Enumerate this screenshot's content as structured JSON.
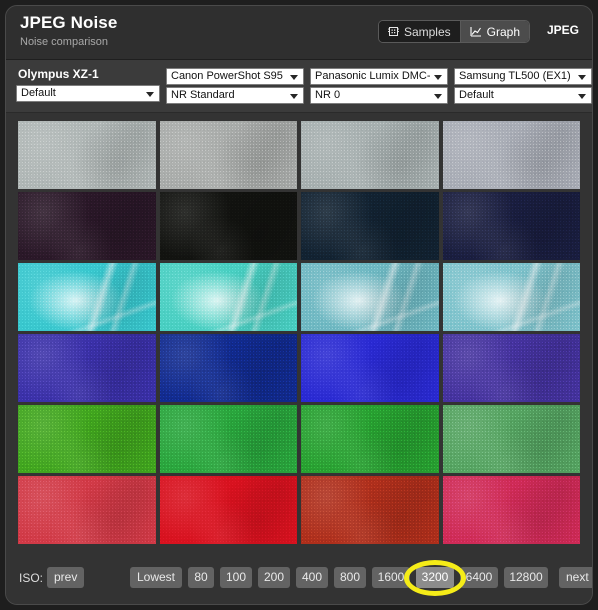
{
  "header": {
    "title": "JPEG Noise",
    "subtitle": "Noise comparison",
    "format_label": "JPEG",
    "view_toggle": [
      {
        "label": "Samples",
        "icon": "chip-icon",
        "active": false
      },
      {
        "label": "Graph",
        "icon": "line-chart-icon",
        "active": true
      }
    ]
  },
  "controls": {
    "columns": [
      {
        "camera": "Olympus XZ-1",
        "setting": "Default",
        "camera_is_select": false
      },
      {
        "camera": "Canon PowerShot S95",
        "setting": "NR Standard",
        "camera_is_select": true
      },
      {
        "camera": "Panasonic Lumix DMC-L",
        "setting": "NR 0",
        "camera_is_select": true
      },
      {
        "camera": "Samsung TL500 (EX1)",
        "setting": "Default",
        "camera_is_select": true
      }
    ]
  },
  "grid": {
    "columns": 4,
    "rows": 6,
    "cells": [
      {
        "base": "#b0b7b6"
      },
      {
        "base": "#a9acaa"
      },
      {
        "base": "#a7b0b0"
      },
      {
        "base": "#a9adb6"
      },
      {
        "base": "#2a1828"
      },
      {
        "base": "#121310"
      },
      {
        "base": "#122231"
      },
      {
        "base": "#1a1e3f"
      },
      {
        "base": "#39c7ce",
        "leaf": true
      },
      {
        "base": "#49cfc2",
        "leaf": true
      },
      {
        "base": "#6fb8c2",
        "leaf": true
      },
      {
        "base": "#7fc3cc",
        "leaf": true
      },
      {
        "base": "#3b31a8"
      },
      {
        "base": "#122b8e"
      },
      {
        "base": "#2a2ad2"
      },
      {
        "base": "#45339e"
      },
      {
        "base": "#41a51f"
      },
      {
        "base": "#2aa53d"
      },
      {
        "base": "#28a031"
      },
      {
        "base": "#56a462"
      },
      {
        "base": "#d13a47"
      },
      {
        "base": "#d8121f"
      },
      {
        "base": "#ae2f1c"
      },
      {
        "base": "#cf2b57"
      }
    ]
  },
  "iso_bar": {
    "label": "ISO:",
    "prev_label": "prev",
    "next_label": "next",
    "selected": "3200",
    "highlighted": "3200",
    "highlight_color": "#f5ec18",
    "values": [
      "Lowest",
      "80",
      "100",
      "200",
      "400",
      "800",
      "1600",
      "3200",
      "6400",
      "12800"
    ]
  }
}
